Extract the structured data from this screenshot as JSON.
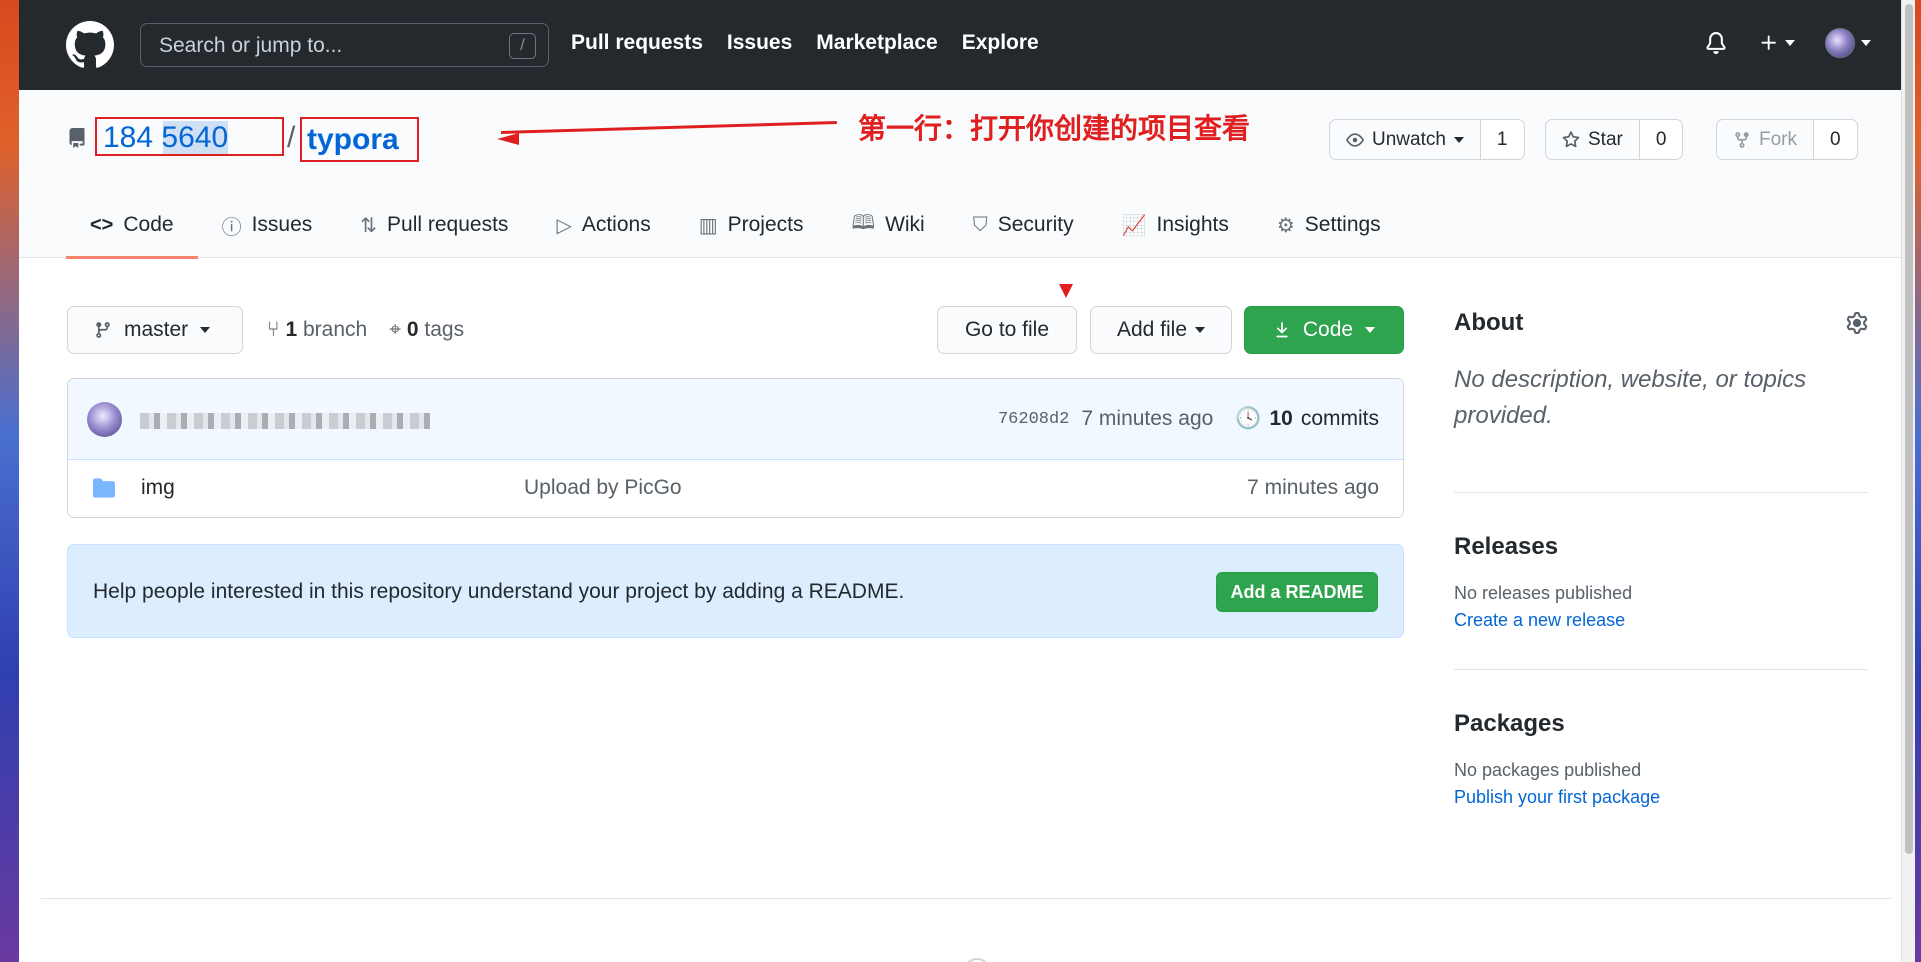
{
  "header": {
    "search_placeholder": "Search or jump to...",
    "search_key": "/",
    "nav": [
      "Pull requests",
      "Issues",
      "Marketplace",
      "Explore"
    ]
  },
  "repo": {
    "owner": "184░░░░40",
    "owner_display": "184    5640",
    "separator": "/",
    "name": "typora",
    "annotation": "第一行：打开你创建的项目查看",
    "watch_label": "Unwatch",
    "watch_count": "1",
    "star_label": "Star",
    "star_count": "0",
    "fork_label": "Fork",
    "fork_count": "0"
  },
  "tabs": [
    {
      "label": "Code",
      "icon": "code-icon"
    },
    {
      "label": "Issues",
      "icon": "issue-icon"
    },
    {
      "label": "Pull requests",
      "icon": "pull-request-icon"
    },
    {
      "label": "Actions",
      "icon": "play-icon"
    },
    {
      "label": "Projects",
      "icon": "project-icon"
    },
    {
      "label": "Wiki",
      "icon": "book-icon"
    },
    {
      "label": "Security",
      "icon": "shield-icon"
    },
    {
      "label": "Insights",
      "icon": "graph-icon"
    },
    {
      "label": "Settings",
      "icon": "gear-icon"
    }
  ],
  "toolbar": {
    "branch": "master",
    "branch_count": "1",
    "branch_label": "branch",
    "tag_count": "0",
    "tag_label": "tags",
    "goto_file": "Go to file",
    "add_file": "Add file",
    "code": "Code"
  },
  "commit": {
    "sha": "76208d2",
    "time": "7 minutes ago",
    "count": "10",
    "count_label": "commits"
  },
  "files": [
    {
      "name": "img",
      "message": "Upload by PicGo",
      "time": "7 minutes ago"
    }
  ],
  "readme": {
    "text": "Help people interested in this repository understand your project by adding a README.",
    "button": "Add a README"
  },
  "sidebar": {
    "about_title": "About",
    "about_desc": "No description, website, or topics provided.",
    "releases_title": "Releases",
    "releases_sub": "No releases published",
    "releases_link": "Create a new release",
    "packages_title": "Packages",
    "packages_sub": "No packages published",
    "packages_link": "Publish your first package"
  },
  "colors": {
    "header_bg": "#24292e",
    "link": "#0366d6",
    "green": "#2ea44f",
    "annotation_red": "#e02020",
    "tab_underline": "#f9826c"
  }
}
